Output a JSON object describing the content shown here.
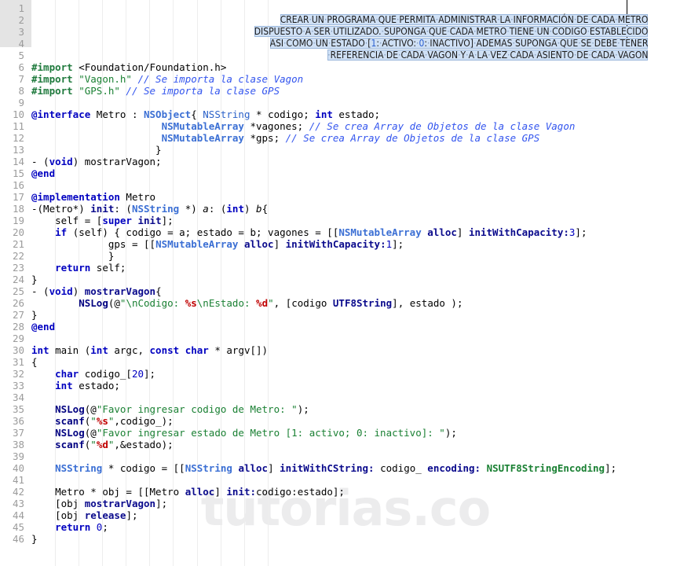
{
  "editor": {
    "watermark": "tutorias.co",
    "language": "Objective-C",
    "total_lines": 46,
    "selection_color": "#cfe0f5",
    "gutter_highlight_color": "#e4e4e4",
    "selected_lines": [
      1,
      2,
      3,
      4
    ]
  },
  "line_numbers": [
    "1",
    "2",
    "3",
    "4",
    "5",
    "6",
    "7",
    "8",
    "9",
    "10",
    "11",
    "12",
    "13",
    "14",
    "15",
    "16",
    "17",
    "18",
    "19",
    "20",
    "21",
    "22",
    "23",
    "24",
    "25",
    "26",
    "27",
    "28",
    "29",
    "30",
    "31",
    "32",
    "33",
    "34",
    "35",
    "36",
    "37",
    "38",
    "39",
    "40",
    "41",
    "42",
    "43",
    "44",
    "45",
    "46"
  ],
  "selected_text": {
    "line1": "CREAR UN PROGRAMA QUE PERMITA ADMINISTRAR LA INFORMACIÓN DE CADA METRO",
    "line2": "DISPUESTO A SER UTILIZADO. SUPONGA QUE CADA METRO TIENE UN CODIGO ESTABLECIDO",
    "line3_a": "ASI COMO UN ESTADO [",
    "line3_n1": "1",
    "line3_b": ": ACTIVO: ",
    "line3_n2": "0",
    "line3_c": ": INACTIVO] ADEMAS SUPONGA QUE SE DEBE TENER",
    "line4": "REFERENCIA DE CADA VAGON Y A LA VEZ CADA ASIENTO DE CADA VAGON"
  },
  "code": {
    "l6": {
      "pre": "#import",
      "hdr": " <Foundation/Foundation.h>"
    },
    "l7": {
      "pre": "#import",
      "str": " \"Vagon.h\" ",
      "cmt": "// Se importa la clase Vagon"
    },
    "l8": {
      "pre": "#import",
      "str": " \"GPS.h\" ",
      "cmt": "// Se importa la clase GPS"
    },
    "l10": {
      "at": "@interface",
      "t1": " Metro : ",
      "cls": "NSObject",
      "t2": "{ ",
      "cls2": "NSString",
      "t3": " * codigo; ",
      "kw": "int",
      "t4": " estado;"
    },
    "l11": {
      "cls": "NSMutableArray",
      "t1": " *vagones; ",
      "cmt": "// Se crea Array de Objetos de la clase Vagon"
    },
    "l12": {
      "cls": "NSMutableArray",
      "t1": " *gps; ",
      "cmt": "// Se crea Array de Objetos de la clase GPS"
    },
    "l13": {
      "t1": "}"
    },
    "l14": {
      "t1": "- (",
      "kw": "void",
      "t2": ") mostrarVagon;"
    },
    "l15": {
      "at": "@end"
    },
    "l17": {
      "at": "@implementation",
      "t1": " Metro"
    },
    "l18": {
      "t1": "-(Metro*) ",
      "msg": "init",
      "t2": ": (",
      "cls": "NSString",
      "t3": " *) ",
      "ital1": "a",
      "t4": ": (",
      "kw": "int",
      "t5": ") ",
      "ital2": "b",
      "t6": "{"
    },
    "l19": {
      "t1": "self = [",
      "kw": "super",
      "t2": " ",
      "msg": "init",
      "t3": "];"
    },
    "l20": {
      "kw": "if",
      "t1": " (self) { codigo = a; estado = b; vagones = [[",
      "cls": "NSMutableArray",
      "t2": " ",
      "msg": "alloc",
      "t3": "] ",
      "msg2": "initWithCapacity:",
      "num": "3",
      "t4": "];"
    },
    "l21": {
      "t1": "gps = [[",
      "cls": "NSMutableArray",
      "t2": " ",
      "msg": "alloc",
      "t3": "] ",
      "msg2": "initWithCapacity:",
      "num": "1",
      "t4": "];"
    },
    "l22": {
      "t1": "}"
    },
    "l23": {
      "kw": "return",
      "t1": " self;"
    },
    "l24": {
      "t1": "}"
    },
    "l25": {
      "t1": "- (",
      "kw": "void",
      "t2": ") ",
      "msg": "mostrarVagon",
      "t3": "{"
    },
    "l26": {
      "fn": "NSLog",
      "t1": "(@",
      "str": "\"\\nCodigo: ",
      "fmt1": "%s",
      "str2": "\\nEstado: ",
      "fmt2": "%d",
      "str3": "\"",
      "t2": ", [codigo ",
      "msg": "UTF8String",
      "t3": "], estado );"
    },
    "l27": {
      "t1": "}"
    },
    "l28": {
      "at": "@end"
    },
    "l30": {
      "kw1": "int",
      "t1": " main (",
      "kw2": "int",
      "t2": " argc, ",
      "kw3": "const",
      "t3": " ",
      "kw4": "char",
      "t4": " * argv[])"
    },
    "l31": {
      "t1": "{"
    },
    "l32": {
      "kw": "char",
      "t1": " codigo_[",
      "num": "20",
      "t2": "];"
    },
    "l33": {
      "kw": "int",
      "t1": " estado;"
    },
    "l35": {
      "fn": "NSLog",
      "t1": "(@",
      "str": "\"Favor ingresar codigo de Metro: \"",
      "t2": ");"
    },
    "l36": {
      "fn": "scanf",
      "t1": "(",
      "str": "\"",
      "fmt": "%s",
      "str2": "\"",
      "t2": ",codigo_);"
    },
    "l37": {
      "fn": "NSLog",
      "t1": "(@",
      "str": "\"Favor ingresar estado de Metro [1: activo; 0: inactivo]: \"",
      "t2": ");"
    },
    "l38": {
      "fn": "scanf",
      "t1": "(",
      "str": "\"",
      "fmt": "%d",
      "str2": "\"",
      "t2": ",&estado);"
    },
    "l40": {
      "cls": "NSString",
      "t1": " * codigo = [[",
      "cls2": "NSString",
      "t2": " ",
      "msg": "alloc",
      "t3": "] ",
      "msg2": "initWithCString:",
      "t4": " codigo_ ",
      "msg3": "encoding:",
      "t5": " ",
      "enc": "NSUTF8StringEncoding",
      "t6": "];"
    },
    "l42": {
      "t1": "Metro * obj = [[Metro ",
      "msg": "alloc",
      "t2": "] ",
      "msg2": "init:",
      "t3": "codigo:estado];"
    },
    "l43": {
      "t1": "[obj ",
      "msg": "mostrarVagon",
      "t2": "];"
    },
    "l44": {
      "t1": "[obj ",
      "msg": "release",
      "t2": "];"
    },
    "l45": {
      "kw": "return",
      "t1": " ",
      "num": "0",
      "t2": ";"
    },
    "l46": {
      "t1": "}"
    }
  }
}
